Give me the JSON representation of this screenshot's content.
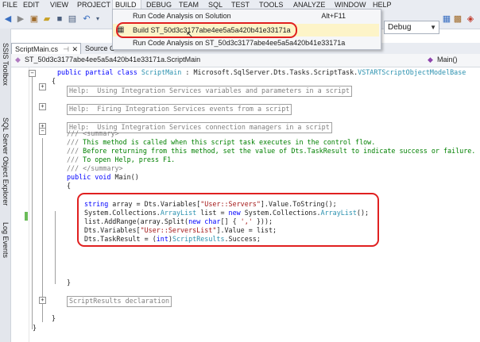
{
  "menubar": {
    "items": [
      "FILE",
      "EDIT",
      "VIEW",
      "PROJECT",
      "BUILD",
      "DEBUG",
      "TEAM",
      "SQL",
      "TEST",
      "TOOLS",
      "ANALYZE",
      "WINDOW",
      "HELP"
    ]
  },
  "toolbar": {
    "configuration": "Debug"
  },
  "build_menu": {
    "items": [
      {
        "label": "Run Code Analysis on Solution",
        "shortcut": "Alt+F11"
      },
      {
        "label": "Build ST_50d3c3177abe4ee5a5a420b41e33171a",
        "shortcut": ""
      },
      {
        "label": "Run Code Analysis on ST_50d3c3177abe4ee5a5a420b41e33171a",
        "shortcut": ""
      }
    ]
  },
  "left_strip": {
    "tabs": [
      "SSIS Toolbox",
      "SQL Server Object Explorer",
      "Log Events"
    ]
  },
  "doc_tabs": [
    "ScriptMain.cs",
    "Source C"
  ],
  "navbar": {
    "class_selector": "ST_50d3c3177abe4ee5a5a420b41e33171a.ScriptMain",
    "member_selector": "Main()"
  },
  "code": {
    "class_decl": {
      "kw": "public partial class",
      "name": " ScriptMain",
      "colon": " : Microsoft.SqlServer.Dts.Tasks.ScriptTask.",
      "base": "VSTARTScriptObjectModelBase"
    },
    "brace_open": "{",
    "region1": "Help:  Using Integration Services variables and parameters in a script",
    "region2": "Help:  Firing Integration Services events from a script",
    "region3": "Help:  Using Integration Services connection managers in a script",
    "doc_summary_open": "/// <summary>",
    "doc_line1_prefix": "///",
    "doc_line1": " This method is called when this script task executes in the control flow.",
    "doc_line2": " Before returning from this method, set the value of Dts.TaskResult to indicate success or failure.",
    "doc_line3": " To open Help, press F1.",
    "doc_summary_close": "/// </summary>",
    "main_sig_kw": "public void",
    "main_sig_name": " Main()",
    "body_open": "{",
    "line_a_kw": "string",
    "line_a_rest1": " array = Dts.Variables[",
    "line_a_str": "\"User::Servers\"",
    "line_a_rest2": "].Value.ToString();",
    "line_b_1": "System.Collections.",
    "line_b_ty": "ArrayList",
    "line_b_2": " list = ",
    "line_b_kw": "new",
    "line_b_3": " System.Collections.",
    "line_b_ty2": "ArrayList",
    "line_b_4": "();",
    "line_c_1": "list.AddRange(array.Split(",
    "line_c_kw": "new char",
    "line_c_2": "[] { ",
    "line_c_str": "','",
    "line_c_3": " }));",
    "line_d_1": "Dts.Variables[",
    "line_d_str": "\"User::ServersList\"",
    "line_d_2": "].Value = list;",
    "line_e_1": "Dts.TaskResult = (",
    "line_e_kw": "int",
    "line_e_2": ")",
    "line_e_ty": "ScriptResults",
    "line_e_3": ".Success;",
    "body_close": "}",
    "region4": "ScriptResults declaration",
    "class_close": "}",
    "ns_close": "}"
  },
  "colors": {
    "highlight_red": "#e02020",
    "keyword": "#0000ff",
    "type": "#2b91af",
    "string": "#a31515",
    "comment": "#008000"
  }
}
